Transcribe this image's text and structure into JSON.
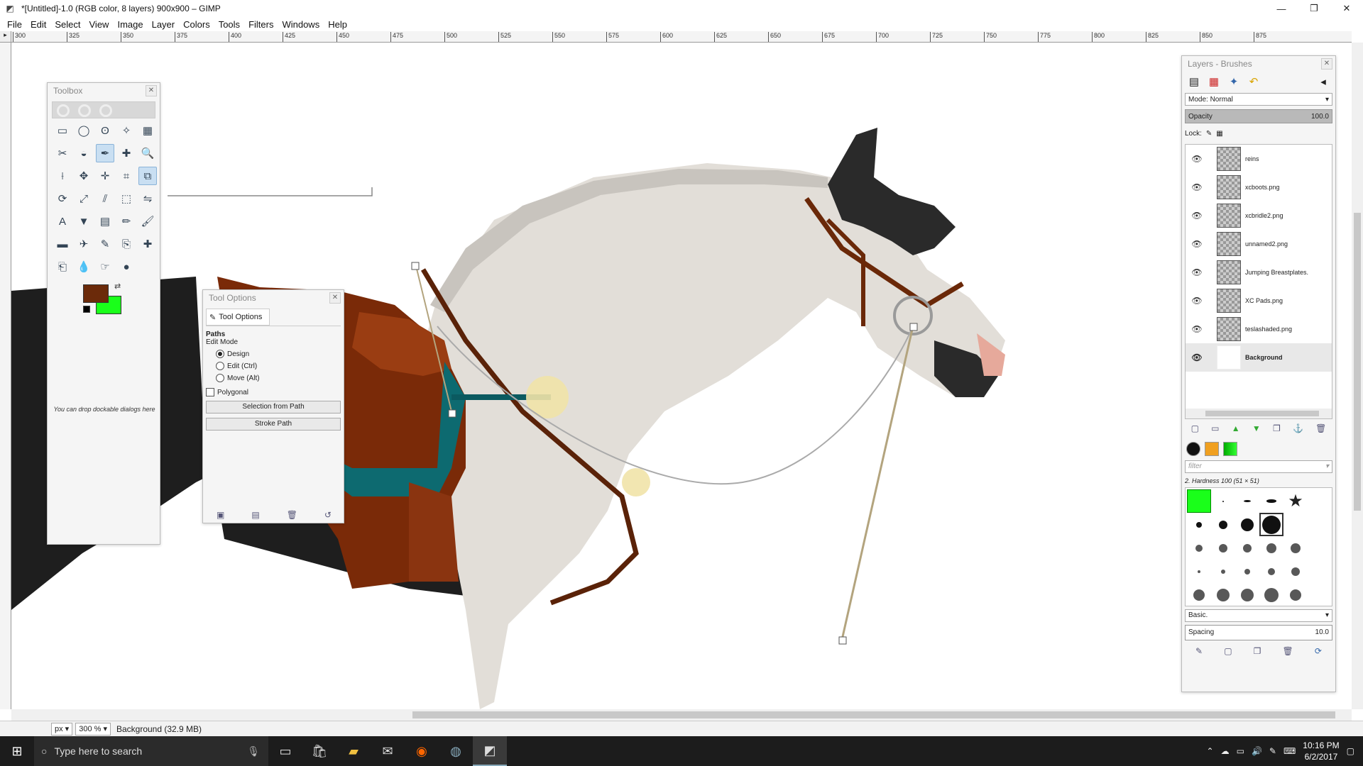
{
  "window": {
    "title": "*[Untitled]-1.0 (RGB color, 8 layers) 900x900 – GIMP",
    "minimize": "—",
    "maximize": "❐",
    "close": "✕"
  },
  "menu": [
    "File",
    "Edit",
    "Select",
    "View",
    "Image",
    "Layer",
    "Colors",
    "Tools",
    "Filters",
    "Windows",
    "Help"
  ],
  "ruler": {
    "top_labels": [
      "300",
      "325",
      "350",
      "375",
      "400",
      "425",
      "450",
      "475",
      "500",
      "525",
      "550",
      "575",
      "600",
      "625",
      "650",
      "675",
      "700",
      "725",
      "750",
      "775",
      "800",
      "825",
      "850",
      "875"
    ]
  },
  "toolbox": {
    "title": "Toolbox",
    "fg_color": "#6b2a0a",
    "bg_color": "#1aff1a",
    "drop_hint": "You can drop dockable dialogs here",
    "tools": [
      "rect-select",
      "ellipse-select",
      "free-select",
      "fuzzy-select",
      "select-by-color",
      "scissors-select",
      "foreground-select",
      "paths",
      "color-picker",
      "zoom",
      "measure",
      "move",
      "align",
      "crop",
      "unified-transform",
      "rotate",
      "scale",
      "shear",
      "perspective",
      "flip",
      "text",
      "bucket-fill",
      "blend",
      "pencil",
      "paintbrush",
      "eraser",
      "airbrush",
      "ink",
      "clone",
      "heal",
      "perspective-clone",
      "blur",
      "smudge",
      "dodge-burn"
    ]
  },
  "tool_options": {
    "title": "Tool Options",
    "tab_label": "Tool Options",
    "section": "Paths",
    "edit_mode_label": "Edit Mode",
    "modes": [
      "Design",
      "Edit (Ctrl)",
      "Move (Alt)"
    ],
    "polygonal": "Polygonal",
    "selection_button": "Selection from Path",
    "stroke_button": "Stroke Path"
  },
  "layers": {
    "title": "Layers - Brushes",
    "mode_label": "Mode:",
    "mode_value": "Normal",
    "opacity_label": "Opacity",
    "opacity_value": "100.0",
    "lock_label": "Lock:",
    "items": [
      {
        "name": "reins",
        "selected": false
      },
      {
        "name": "xcboots.png",
        "selected": false
      },
      {
        "name": "xcbridle2.png",
        "selected": false
      },
      {
        "name": "unnamed2.png",
        "selected": false
      },
      {
        "name": "Jumping Breastplates.",
        "selected": false
      },
      {
        "name": "XC Pads.png",
        "selected": false
      },
      {
        "name": "teslashaded.png",
        "selected": false
      },
      {
        "name": "Background",
        "selected": true
      }
    ]
  },
  "brushes": {
    "filter_placeholder": "filter",
    "current": "2. Hardness 100 (51 × 51)",
    "preset": "Basic.",
    "spacing_label": "Spacing",
    "spacing_value": "10.0"
  },
  "statusbar": {
    "unit": "px",
    "zoom": "300 %",
    "status": "Background (32.9 MB)"
  },
  "taskbar": {
    "search_placeholder": "Type here to search",
    "time": "10:16 PM",
    "date": "6/2/2017"
  }
}
